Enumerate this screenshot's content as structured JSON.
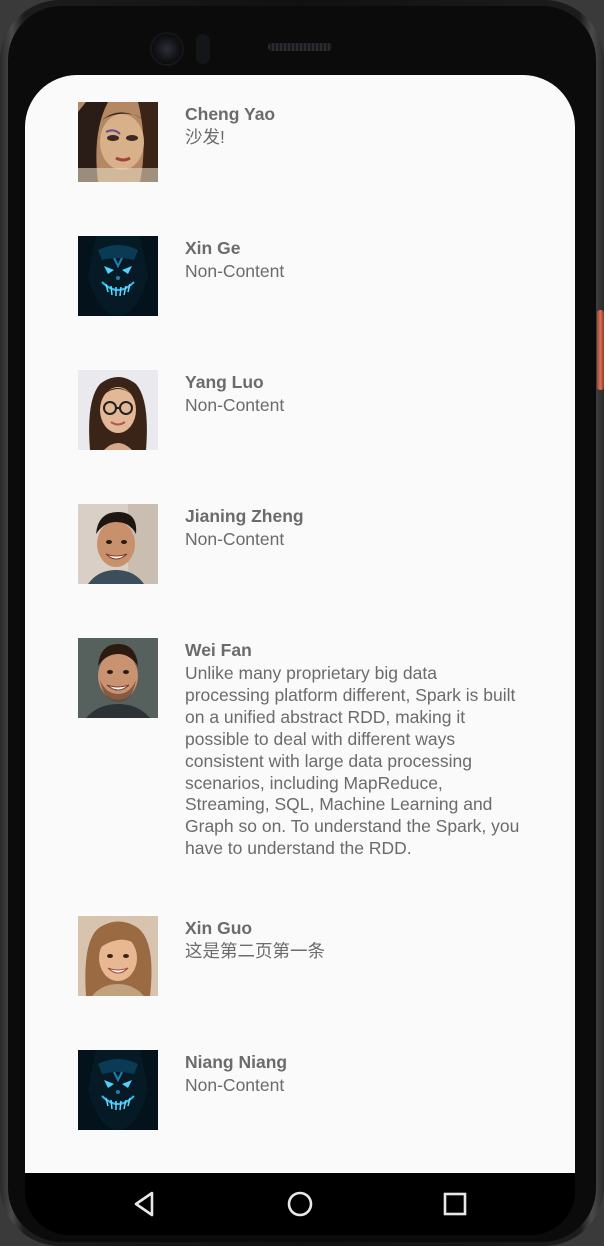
{
  "contacts": [
    {
      "name": "Cheng Yao",
      "content": "沙发!",
      "avatar": "woman-face-avatar"
    },
    {
      "name": "Xin Ge",
      "content": "Non-Content",
      "avatar": "neon-mask-avatar"
    },
    {
      "name": "Yang Luo",
      "content": "Non-Content",
      "avatar": "woman-glasses-avatar"
    },
    {
      "name": "Jianing Zheng",
      "content": "Non-Content",
      "avatar": "smiling-man-avatar"
    },
    {
      "name": "Wei Fan",
      "content": "Unlike many proprietary big data processing platform different, Spark is built on a unified abstract RDD, making it possible to deal with different ways consistent with large data processing scenarios, including MapReduce, Streaming, SQL, Machine Learning and Graph so on. To understand the Spark, you have to understand the RDD.",
      "avatar": "bearded-man-avatar"
    },
    {
      "name": "Xin Guo",
      "content": "这是第二页第一条",
      "avatar": "smiling-woman-avatar"
    },
    {
      "name": "Niang Niang",
      "content": "Non-Content",
      "avatar": "neon-mask-avatar"
    }
  ],
  "navbar": {
    "back_icon": "back-triangle-icon",
    "home_icon": "home-circle-icon",
    "recents_icon": "recents-square-icon"
  },
  "colors": {
    "screen_background": "#fafafa",
    "text": "#6b6b6b",
    "navbar": "#000000",
    "accent_button": "#d9705a"
  }
}
